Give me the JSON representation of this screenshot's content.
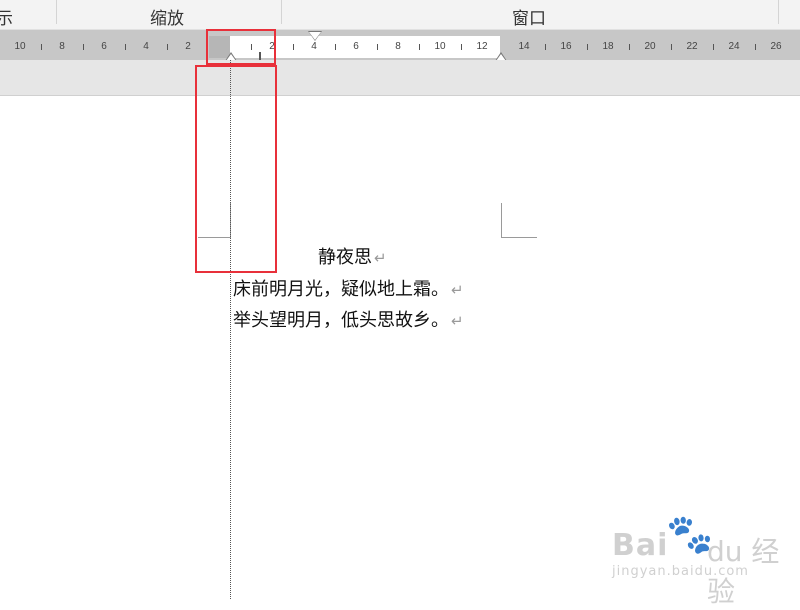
{
  "ribbon": {
    "groups": [
      {
        "label": "示"
      },
      {
        "label": "缩放"
      },
      {
        "label": "窗口"
      }
    ]
  },
  "ruler": {
    "ticks_left": [
      "10",
      "8",
      "6",
      "4",
      "2"
    ],
    "ticks_right": [
      "2",
      "4",
      "6",
      "8",
      "10",
      "12",
      "14",
      "16",
      "18",
      "20",
      "22",
      "24",
      "26"
    ]
  },
  "document": {
    "title": "静夜思",
    "lines": [
      "床前明月光，疑似地上霜。",
      "举头望明月，低头思故乡。"
    ],
    "paragraph_mark": "↵"
  },
  "watermark": {
    "brand": "Bai",
    "brand_suffix": "du 经验",
    "url": "jingyan.baidu.com"
  },
  "colors": {
    "highlight": "#e8303a",
    "ruler_bg": "#c7c7c7",
    "ruler_text_area": "#ffffff"
  }
}
